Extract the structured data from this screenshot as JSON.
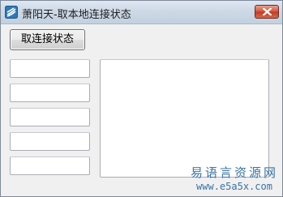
{
  "window": {
    "title": "萧阳天-取本地连接状态"
  },
  "main": {
    "get_status_button": "取连接状态"
  },
  "watermark": {
    "name": "易语言资源网",
    "url": "www.e5a5x.com"
  },
  "icons": {
    "app": "app-logo-icon",
    "close": "close-icon"
  },
  "colors": {
    "close_button": "#c9402a",
    "watermark": "#3a74a6"
  }
}
